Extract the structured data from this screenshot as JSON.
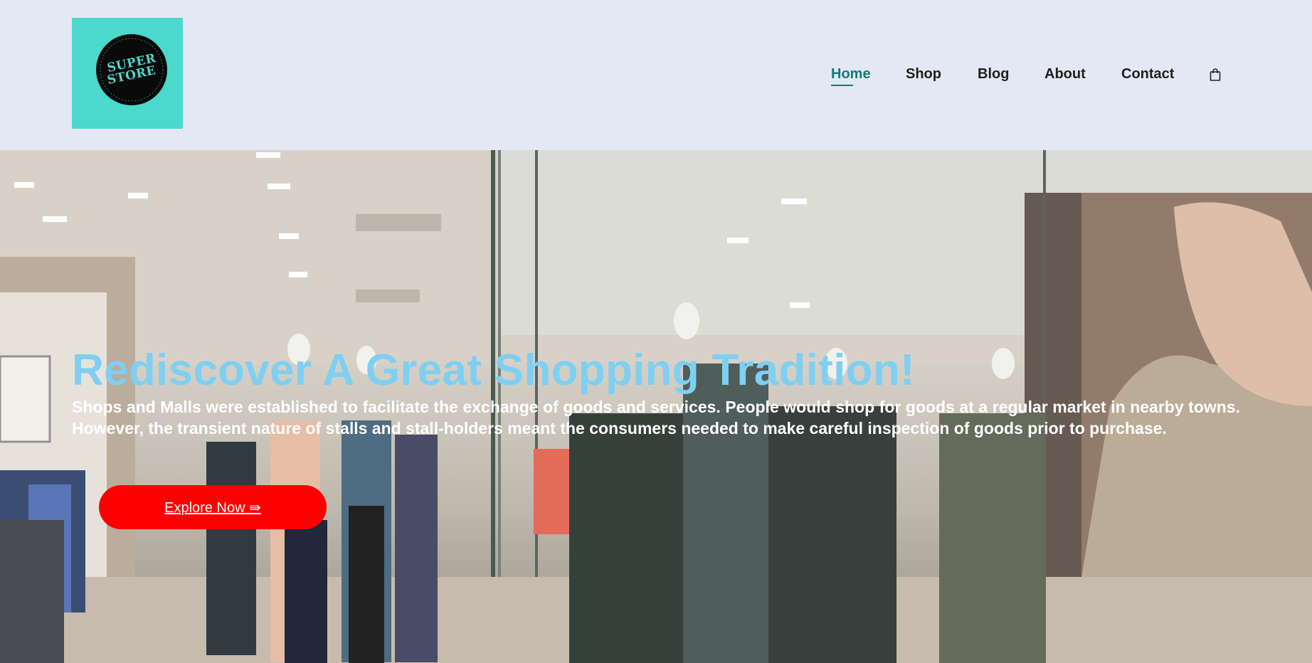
{
  "logo": {
    "line1": "SUPER",
    "line2": "STORE",
    "colors": {
      "background": "#4bd8cd",
      "circle": "#0a0a0a"
    }
  },
  "nav": {
    "items": [
      {
        "label": "Home",
        "active": true
      },
      {
        "label": "Shop",
        "active": false
      },
      {
        "label": "Blog",
        "active": false
      },
      {
        "label": "About",
        "active": false
      },
      {
        "label": "Contact",
        "active": false
      }
    ],
    "cart_icon": "shopping-bag-icon",
    "active_color": "#137a74"
  },
  "hero": {
    "title": "Rediscover A Great Shopping Tradition!",
    "text": "Shops and Malls were established to facilitate the exchange of goods and services. People would shop for goods at a regular market in nearby towns. However, the transient nature of stalls and stall-holders meant the consumers needed to make careful inspection of goods prior to purchase.",
    "button_label": "Explore Now ⇛",
    "title_color": "#7fcff2",
    "button_color": "#ff0000"
  }
}
